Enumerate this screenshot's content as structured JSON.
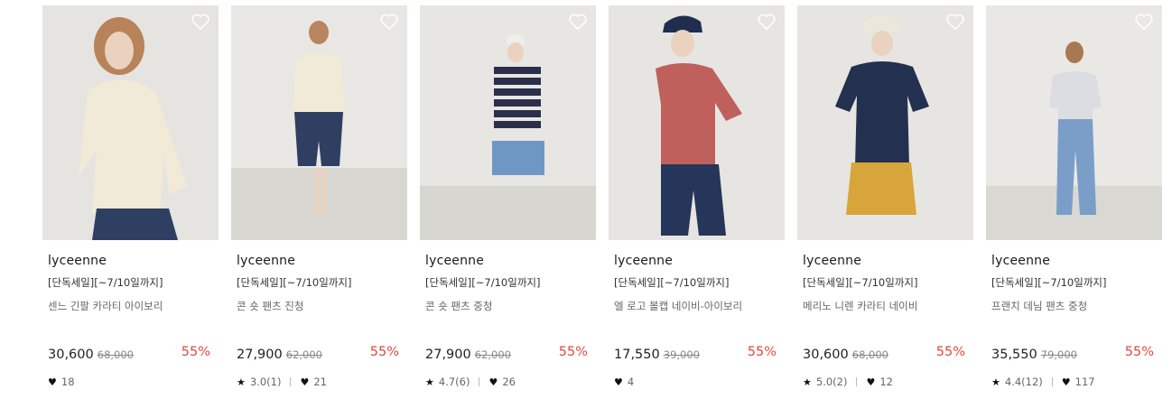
{
  "products": [
    {
      "brand": "lyceenne",
      "tag": "[단독세일][~7/10일까지]",
      "name": "센느 긴팔 카라티 아이보리",
      "price": "30,600",
      "original_price": "68,000",
      "discount": "55%",
      "rating": "",
      "likes": "18"
    },
    {
      "brand": "lyceenne",
      "tag": "[단독세일][~7/10일까지]",
      "name": "콘 숏 팬츠 진청",
      "price": "27,900",
      "original_price": "62,000",
      "discount": "55%",
      "rating": "3.0(1)",
      "likes": "21"
    },
    {
      "brand": "lyceenne",
      "tag": "[단독세일][~7/10일까지]",
      "name": "콘 숏 팬츠 중청",
      "price": "27,900",
      "original_price": "62,000",
      "discount": "55%",
      "rating": "4.7(6)",
      "likes": "26"
    },
    {
      "brand": "lyceenne",
      "tag": "[단독세일][~7/10일까지]",
      "name": "엘 로고 볼캡 네이비-아이보리",
      "price": "17,550",
      "original_price": "39,000",
      "discount": "55%",
      "rating": "",
      "likes": "4"
    },
    {
      "brand": "lyceenne",
      "tag": "[단독세일][~7/10일까지]",
      "name": "메리노 니렌 카라티 네이비",
      "price": "30,600",
      "original_price": "68,000",
      "discount": "55%",
      "rating": "5.0(2)",
      "likes": "12"
    },
    {
      "brand": "lyceenne",
      "tag": "[단독세일][~7/10일까지]",
      "name": "프랜치 데님 팬츠 중청",
      "price": "35,550",
      "original_price": "79,000",
      "discount": "55%",
      "rating": "4.4(12)",
      "likes": "117"
    }
  ],
  "icons": {
    "wishlist": "heart-outline-icon",
    "rating": "star-icon",
    "likes": "heart-filled-icon"
  },
  "colors": {
    "discount": "#e2483d",
    "photo_bg": "#e6e5e2"
  }
}
